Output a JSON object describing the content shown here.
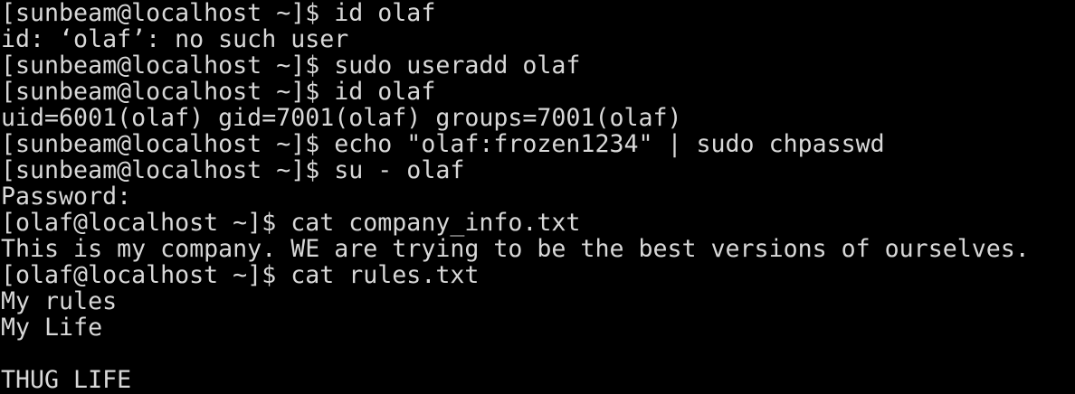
{
  "terminal": {
    "lines": [
      "[sunbeam@localhost ~]$ id olaf",
      "id: ‘olaf’: no such user",
      "[sunbeam@localhost ~]$ sudo useradd olaf",
      "[sunbeam@localhost ~]$ id olaf",
      "uid=6001(olaf) gid=7001(olaf) groups=7001(olaf)",
      "[sunbeam@localhost ~]$ echo \"olaf:frozen1234\" | sudo chpasswd",
      "[sunbeam@localhost ~]$ su - olaf",
      "Password:",
      "[olaf@localhost ~]$ cat company_info.txt",
      "This is my company. WE are trying to be the best versions of ourselves.",
      "[olaf@localhost ~]$ cat rules.txt",
      "My rules",
      "My Life",
      "",
      "THUG LIFE"
    ]
  },
  "colors": {
    "background": "#000000",
    "foreground": "#d8d8d8"
  }
}
